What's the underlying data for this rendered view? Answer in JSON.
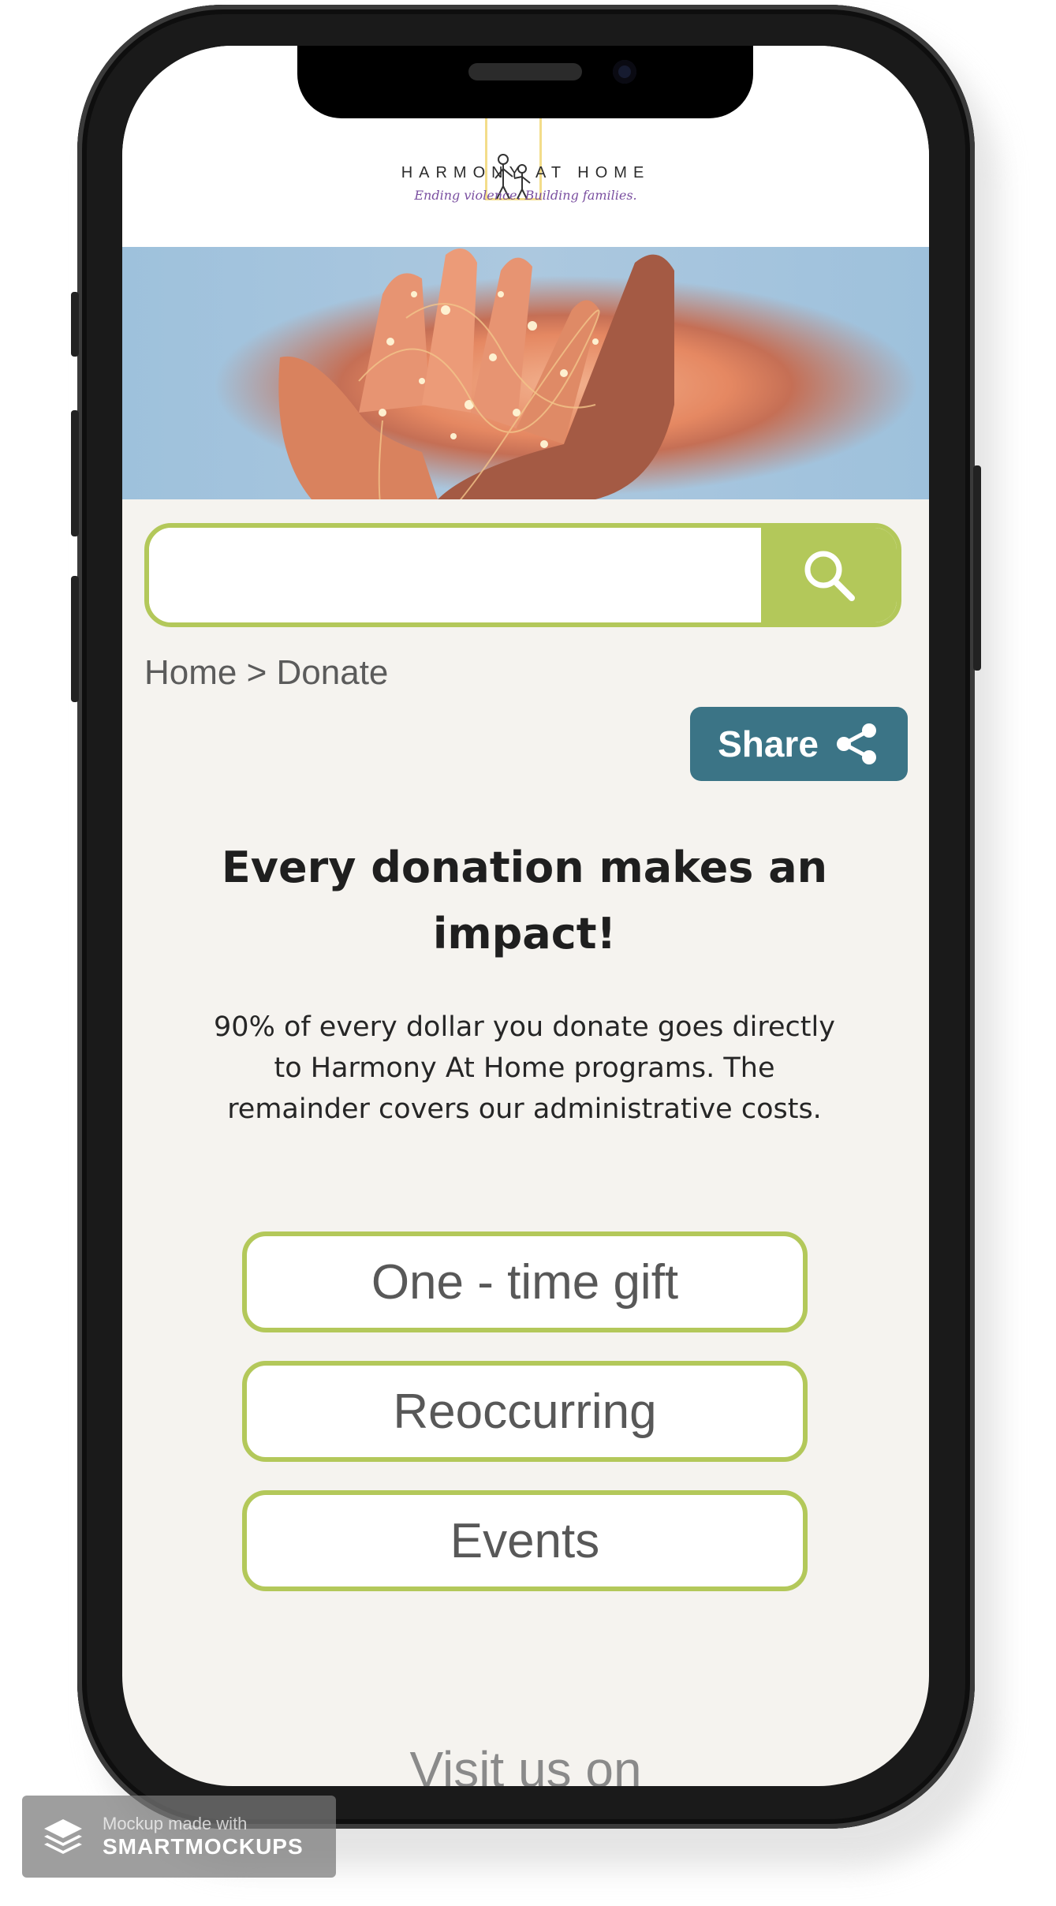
{
  "header": {
    "title": "HARMONY AT HOME",
    "tagline": "Ending violence. Building families."
  },
  "search": {
    "placeholder": "",
    "icon": "search-icon"
  },
  "breadcrumb": "Home > Donate",
  "share": {
    "label": "Share",
    "icon": "share-icon"
  },
  "main": {
    "headline": "Every donation makes an impact!",
    "description": "90% of every dollar you donate goes directly to Harmony At Home programs. The remainder covers our administrative costs.",
    "options": [
      "One - time gift",
      "Reoccurring",
      "Events"
    ]
  },
  "footer": {
    "visit_text": "Visit us on"
  },
  "watermark": {
    "small": "Mockup made with",
    "big": "SMARTMOCKUPS"
  },
  "colors": {
    "accent": "#b3c85a",
    "share_bg": "#3b7486",
    "page_bg": "#f5f3ef"
  }
}
